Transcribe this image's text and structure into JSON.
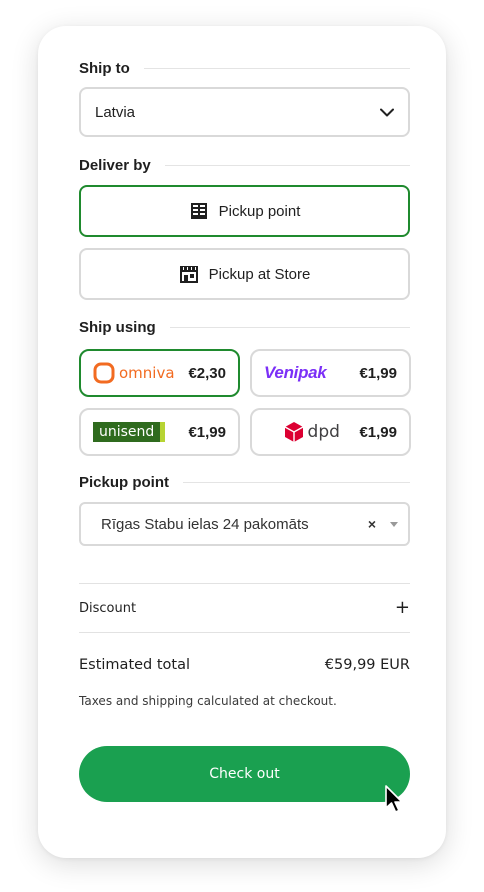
{
  "ship_to": {
    "title": "Ship to",
    "country": "Latvia"
  },
  "deliver_by": {
    "title": "Deliver by",
    "options": [
      {
        "label": "Pickup point",
        "icon": "locker-icon",
        "selected": true
      },
      {
        "label": "Pickup at Store",
        "icon": "storefront-icon",
        "selected": false
      }
    ]
  },
  "ship_using": {
    "title": "Ship using",
    "carriers": [
      {
        "name": "omniva",
        "price": "€2,30",
        "selected": true,
        "color": "#f26b21"
      },
      {
        "name": "Venipak",
        "price": "€1,99",
        "selected": false,
        "color": "#7b2ff7"
      },
      {
        "name": "unisend",
        "price": "€1,99",
        "selected": false,
        "color": "#2f6b1e"
      },
      {
        "name": "dpd",
        "price": "€1,99",
        "selected": false,
        "color": "#dc0032"
      }
    ]
  },
  "pickup_point": {
    "title": "Pickup point",
    "value": "Rīgas Stabu ielas 24 pakomāts",
    "clear_symbol": "×"
  },
  "discount": {
    "label": "Discount",
    "toggle_symbol": "+"
  },
  "totals": {
    "label": "Estimated total",
    "value": "€59,99 EUR",
    "note": "Taxes and shipping calculated at checkout."
  },
  "checkout": {
    "label": "Check out"
  },
  "colors": {
    "accent_green": "#1aa050",
    "selected_border": "#1f8a2e"
  }
}
